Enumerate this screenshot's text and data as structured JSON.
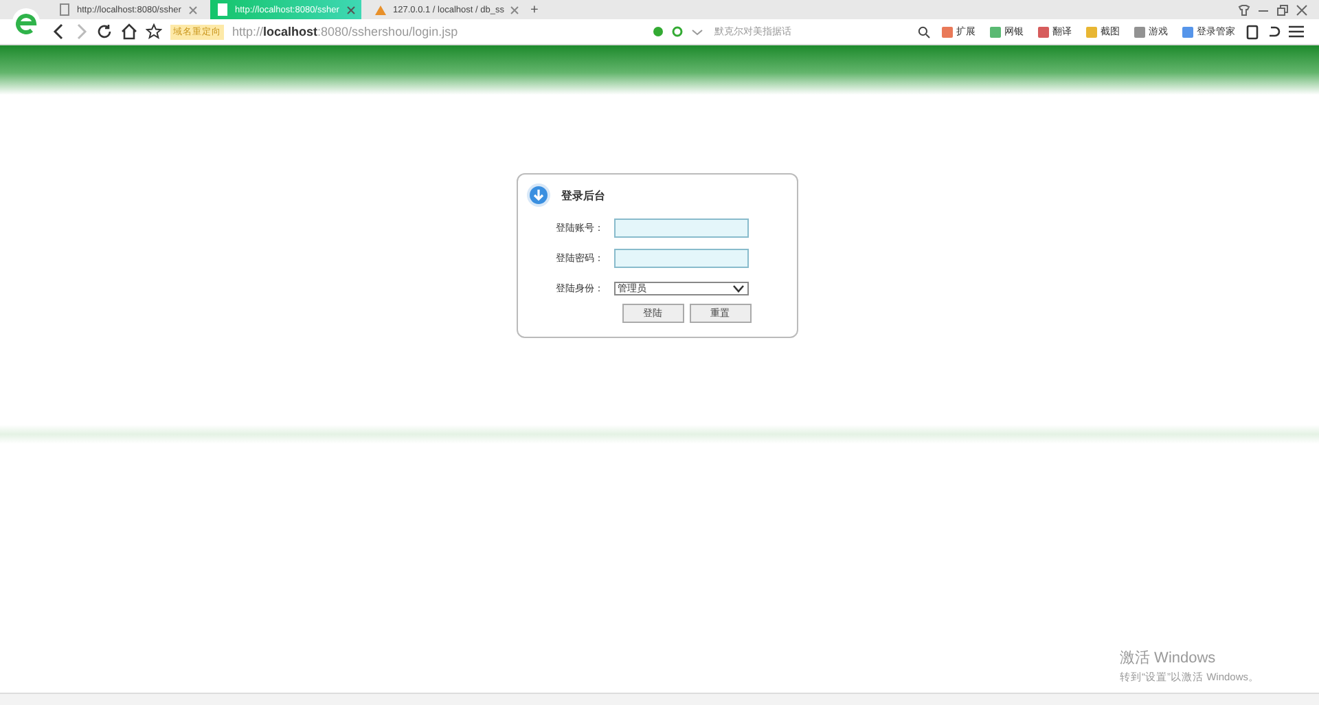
{
  "browser": {
    "tabs": [
      {
        "title": "http://localhost:8080/ssher",
        "selected": false,
        "kind": "page"
      },
      {
        "title": "http://localhost:8080/ssher",
        "selected": true,
        "kind": "page"
      },
      {
        "title": "127.0.0.1 / localhost / db_ss",
        "selected": false,
        "kind": "db"
      }
    ],
    "new_tab": "+",
    "redirect_badge": "域名重定向",
    "url_prefix": "http://",
    "url_host": "localhost",
    "url_rest": ":8080/sshershou/login.jsp",
    "search": {
      "placeholder": "默克尔对美指据话"
    },
    "toolbar": [
      "扩展",
      "网银",
      "翻译",
      "截图",
      "游戏",
      "登录管家"
    ]
  },
  "login": {
    "title": "登录后台",
    "fields": [
      {
        "label": "登陆账号：",
        "kind": "text"
      },
      {
        "label": "登陆密码：",
        "kind": "password"
      },
      {
        "label": "登陆身份：",
        "kind": "select",
        "value": "管理员"
      }
    ],
    "buttons": [
      "登陆",
      "重置"
    ]
  },
  "os_notice": {
    "title": "激活 Windows",
    "text": "转到“设置”以激活 Windows。"
  }
}
